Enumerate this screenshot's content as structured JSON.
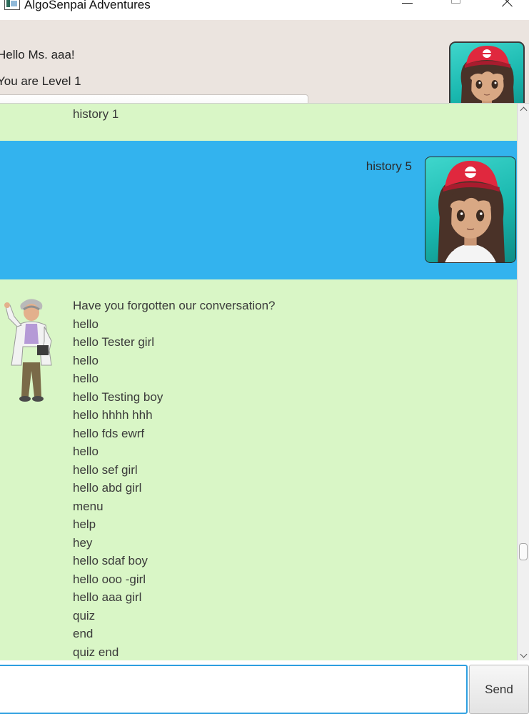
{
  "window": {
    "title": "AlgoSenpai Adventures"
  },
  "header": {
    "greeting": "Hello Ms. aaa!",
    "level_text": "You are Level 1",
    "level_progress": 0
  },
  "chat": {
    "messages": [
      {
        "sender": "user",
        "text": "history 1"
      },
      {
        "sender": "user",
        "text": "history 5"
      },
      {
        "sender": "bot",
        "lines": [
          "Have you forgotten our conversation?",
          "hello",
          "hello Tester girl",
          "hello",
          "hello",
          "hello Testing boy",
          "hello hhhh hhh",
          "hello fds ewrf",
          "hello",
          "hello sef girl",
          "hello abd girl",
          "menu",
          "help",
          "hey",
          "hello sdaf boy",
          "hello ooo -girl",
          "hello aaa girl",
          "quiz",
          "end",
          "quiz end"
        ]
      }
    ]
  },
  "input": {
    "value": "",
    "send_label": "Send"
  },
  "colors": {
    "header_bg": "#ebe4df",
    "bot_bubble": "#d9f6c6",
    "user_bubble": "#33b3ee",
    "input_focus": "#2e9fe0"
  },
  "icons": {
    "app": "app-window-icon",
    "user_avatar": "trainer-girl-avatar",
    "bot_avatar": "professor-avatar"
  }
}
